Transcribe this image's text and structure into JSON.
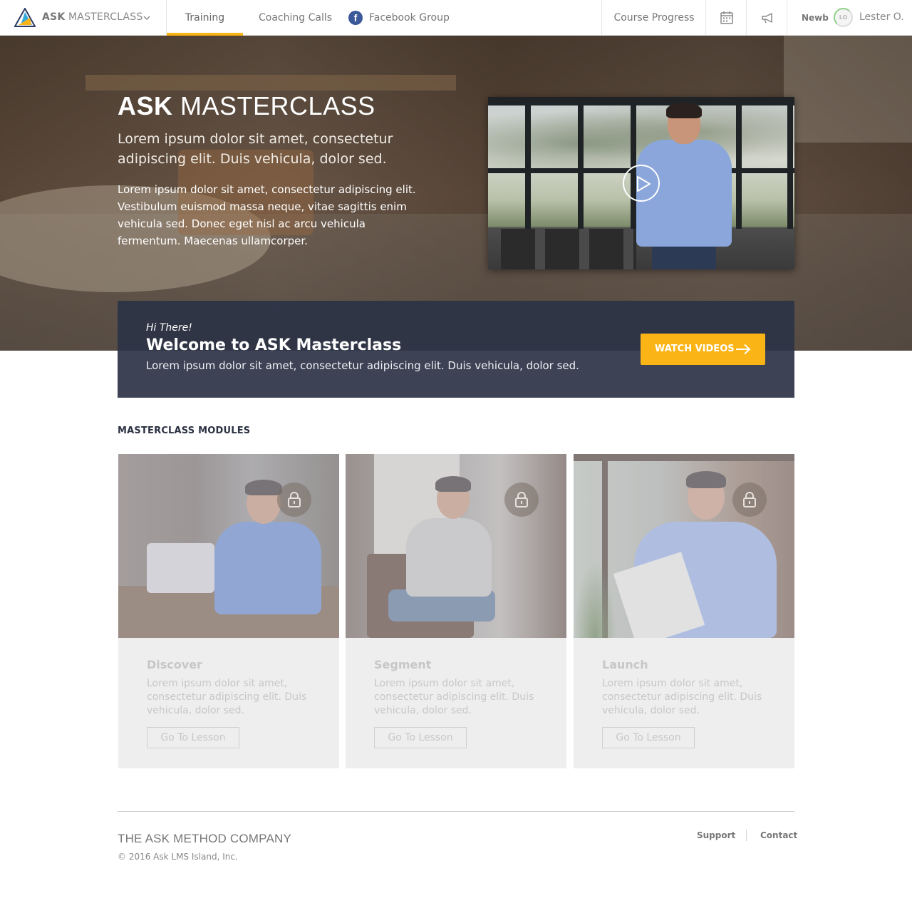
{
  "brand": {
    "name_bold": "ASK",
    "name_light": "MASTERCLASS",
    "logo_icon": "triangle-logo-icon",
    "menu_icon": "chevron-down-icon"
  },
  "nav": {
    "tabs": [
      {
        "label": "Training",
        "active": true
      },
      {
        "label": "Coaching Calls",
        "active": false
      },
      {
        "label": "Facebook Group",
        "active": false,
        "icon": "facebook-icon"
      }
    ],
    "facebook_glyph": "f",
    "course_progress": "Course Progress",
    "calendar_icon": "calendar-icon",
    "announcements_icon": "megaphone-icon",
    "user": {
      "rank": "Newb",
      "initials": "LO",
      "name": "Lester O."
    },
    "accent_color": "#fbb416"
  },
  "hero": {
    "title_bold": "ASK",
    "title_light": "MASTERCLASS",
    "subtitle": "Lorem ipsum dolor sit amet, consectetur adipiscing elit. Duis vehicula, dolor sed.",
    "body": "Lorem ipsum dolor sit amet, consectetur adipiscing elit. Vestibulum euismod massa neque, vitae sagittis enim vehicula sed. Donec eget nisl ac arcu vehicula fermentum. Maecenas ullamcorper.",
    "video_play_icon": "play-icon"
  },
  "welcome": {
    "greeting": "Hi There!",
    "title": "Welcome to ASK Masterclass",
    "description": "Lorem ipsum dolor sit amet, consectetur adipiscing elit. Duis vehicula, dolor sed.",
    "cta_label": "WATCH VIDEOS",
    "cta_icon": "arrow-right-icon",
    "bar_color": "#2c3347"
  },
  "modules": {
    "heading": "MASTERCLASS MODULES",
    "lock_icon": "lock-icon",
    "items": [
      {
        "title": "Discover",
        "description": "Lorem ipsum dolor sit amet, consectetur adipiscing elit. Duis vehicula, dolor sed.",
        "button": "Go To Lesson",
        "locked": true
      },
      {
        "title": "Segment",
        "description": "Lorem ipsum dolor sit amet, consectetur adipiscing elit. Duis vehicula, dolor sed.",
        "button": "Go To Lesson",
        "locked": true
      },
      {
        "title": "Launch",
        "description": "Lorem ipsum dolor sit amet, consectetur adipiscing elit. Duis vehicula, dolor sed.",
        "button": "Go To Lesson",
        "locked": true
      }
    ]
  },
  "footer": {
    "company": "THE ASK METHOD COMPANY",
    "copyright": "© 2016 Ask LMS Island, Inc.",
    "links": [
      "Support",
      "Contact"
    ]
  }
}
